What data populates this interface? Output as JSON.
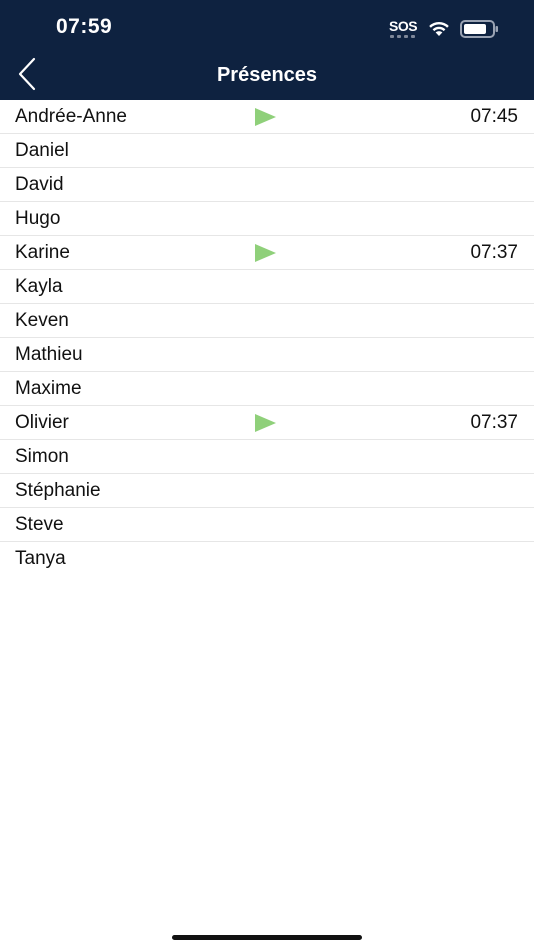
{
  "status_bar": {
    "time": "07:59",
    "sos": "SOS"
  },
  "nav": {
    "title": "Présences",
    "back_icon": "chevron-left-icon"
  },
  "attendance": {
    "rows": [
      {
        "name": "Andrée-Anne",
        "present": true,
        "time": "07:45"
      },
      {
        "name": "Daniel",
        "present": false,
        "time": ""
      },
      {
        "name": "David",
        "present": false,
        "time": ""
      },
      {
        "name": "Hugo",
        "present": false,
        "time": ""
      },
      {
        "name": "Karine",
        "present": true,
        "time": "07:37"
      },
      {
        "name": "Kayla",
        "present": false,
        "time": ""
      },
      {
        "name": "Keven",
        "present": false,
        "time": ""
      },
      {
        "name": "Mathieu",
        "present": false,
        "time": ""
      },
      {
        "name": "Maxime",
        "present": false,
        "time": ""
      },
      {
        "name": "Olivier",
        "present": true,
        "time": "07:37"
      },
      {
        "name": "Simon",
        "present": false,
        "time": ""
      },
      {
        "name": "Stéphanie",
        "present": false,
        "time": ""
      },
      {
        "name": "Steve",
        "present": false,
        "time": ""
      },
      {
        "name": "Tanya",
        "present": false,
        "time": ""
      }
    ]
  },
  "colors": {
    "header_bg": "#0e2240",
    "present_arrow": "#8fd07a"
  }
}
